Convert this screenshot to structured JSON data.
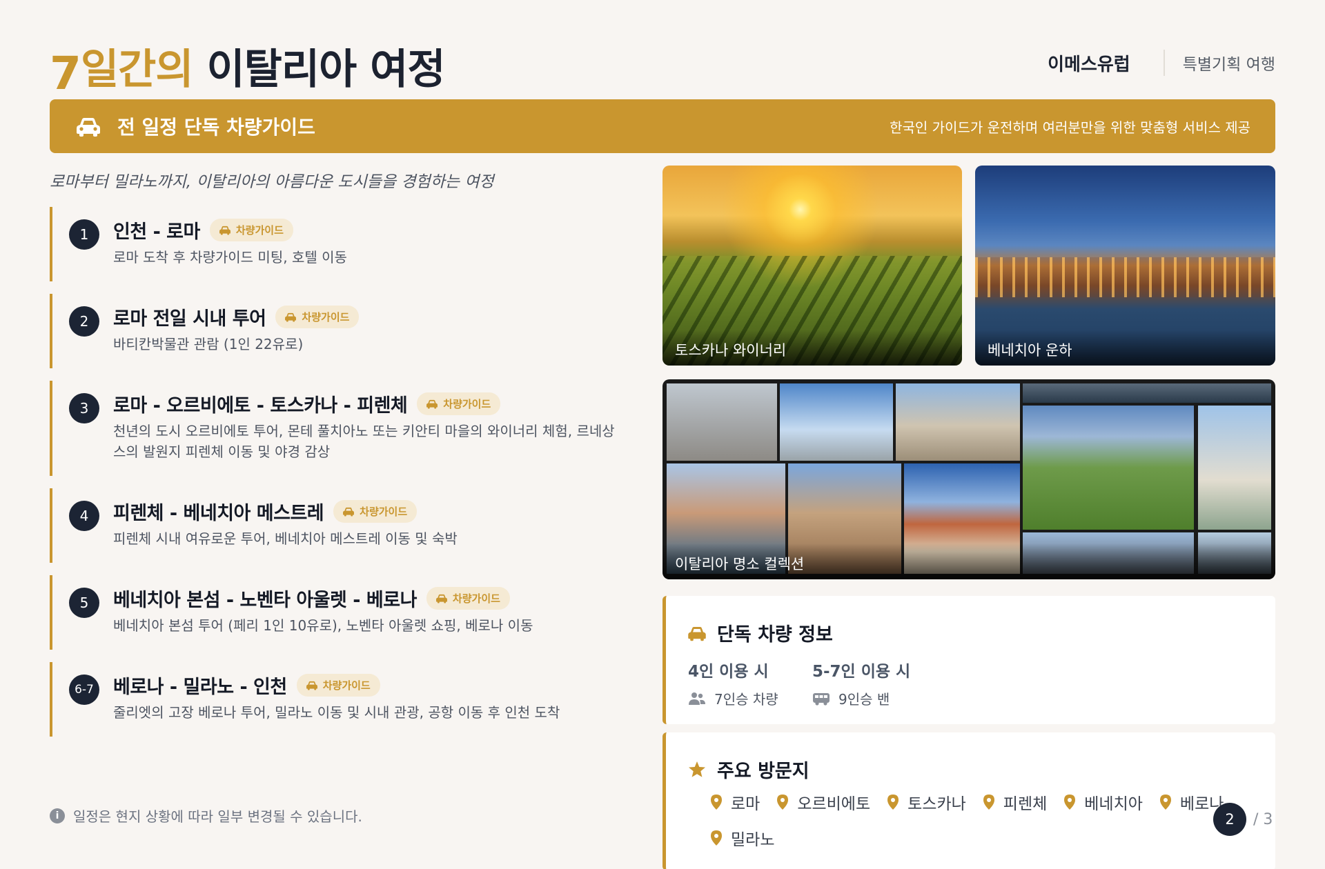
{
  "header": {
    "title_num": "7",
    "title_gold": "일간의",
    "title_dark": "이탈리아 여정",
    "brand": "이메스유럽",
    "brand_sub": "특별기획 여행"
  },
  "banner": {
    "icon": "car-icon",
    "title": "전 일정 단독 차량가이드",
    "desc": "한국인 가이드가 운전하며 여러분만을 위한 맞춤형 서비스 제공"
  },
  "subtitle": "로마부터 밀라노까지, 이탈리아의 아름다운 도시들을 경험하는 여정",
  "itinerary": [
    {
      "num": "1",
      "title": "인천 - 로마",
      "tag": "차량가이드",
      "desc": "로마 도착 후 차량가이드 미팅, 호텔 이동"
    },
    {
      "num": "2",
      "title": "로마 전일 시내 투어",
      "tag": "차량가이드",
      "desc": "바티칸박물관 관람 (1인 22유로)"
    },
    {
      "num": "3",
      "title": "로마 - 오르비에토 - 토스카나 - 피렌체",
      "tag": "차량가이드",
      "desc": "천년의 도시 오르비에토 투어, 몬테 풀치아노 또는 키안티 마을의 와이너리 체험, 르네상스의 발원지 피렌체 이동 및 야경 감상"
    },
    {
      "num": "4",
      "title": "피렌체 - 베네치아 메스트레",
      "tag": "차량가이드",
      "desc": "피렌체 시내 여유로운 투어, 베네치아 메스트레 이동 및 숙박"
    },
    {
      "num": "5",
      "title": "베네치아 본섬 - 노벤타 아울렛 - 베로나",
      "tag": "차량가이드",
      "desc": "베네치아 본섬 투어 (페리 1인 10유로), 노벤타 아울렛 쇼핑, 베로나 이동"
    },
    {
      "num": "6-7",
      "title": "베로나 - 밀라노 - 인천",
      "tag": "차량가이드",
      "desc": "줄리엣의 고장 베로나 투어, 밀라노 이동 및 시내 관광, 공항 이동 후 인천 도착"
    }
  ],
  "note": "일정은 현지 상황에 따라 일부 변경될 수 있습니다.",
  "photos": {
    "p1": "토스카나 와이너리",
    "p2": "베네치아 운하",
    "p3": "이탈리아 명소 컬렉션"
  },
  "vehicle_card": {
    "title": "단독 차량 정보",
    "options": [
      {
        "label": "4인 이용 시",
        "detail": "7인승 차량",
        "icon": "users-icon"
      },
      {
        "label": "5-7인 이용 시",
        "detail": "9인승 밴",
        "icon": "van-icon"
      }
    ]
  },
  "dest_card": {
    "title": "주요 방문지",
    "places": [
      "로마",
      "오르비에토",
      "토스카나",
      "피렌체",
      "베네치아",
      "베로나",
      "밀라노"
    ]
  },
  "pager": {
    "current": "2",
    "total": "/ 3"
  },
  "colors": {
    "accent": "#c9962f",
    "navy": "#1c2434",
    "background": "#f8f5f2"
  }
}
